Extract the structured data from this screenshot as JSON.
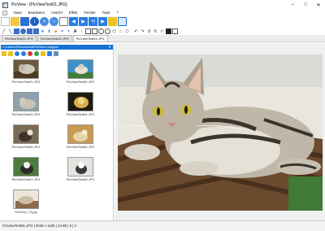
{
  "window": {
    "title": "PicView - [PicViewTest01.JPG]",
    "minimize_glyph": "–",
    "maximize_glyph": "□",
    "close_glyph": "✕"
  },
  "menu": [
    "Datei",
    "Bearbeiten",
    "Ansicht",
    "Effekt",
    "Fenster",
    "Tools",
    "?"
  ],
  "tabs": [
    "PicViewTest01.JPG",
    "PicViewTest02.JPG",
    "PicViewTest03.JPG"
  ],
  "browser": {
    "path": "C:\\Users\\Pictures\\Kat\\PicView Images\\"
  },
  "thumbnails": [
    {
      "label": "PicViewTest01.JPG",
      "icon": "cat-photo"
    },
    {
      "label": "PicViewTest02.JPG",
      "icon": "cat-photo"
    },
    {
      "label": "PicViewTest03.JPG",
      "icon": "cat-photo"
    },
    {
      "label": "PicViewTest04.JPG",
      "icon": "cat-photo"
    },
    {
      "label": "PicViewTest05.JPG",
      "icon": "cat-photo"
    },
    {
      "label": "PicViewTest06.JPG",
      "icon": "cat-photo"
    },
    {
      "label": "PicViewTest07.JPG",
      "icon": "cat-photo"
    },
    {
      "label": "PicViewTest08.JPG",
      "icon": "cat-photo"
    },
    {
      "label": "PicView_70.jpg",
      "icon": "cat-photo"
    }
  ],
  "status": {
    "text": "PicViewTest01.JPG | 2048 x 1536 | 24 Bit | 5 | 3"
  },
  "colors": {
    "accent": "#1672d4",
    "tab_bg": "#e3e3e3",
    "viewer_bg": "#f0f0f0"
  }
}
